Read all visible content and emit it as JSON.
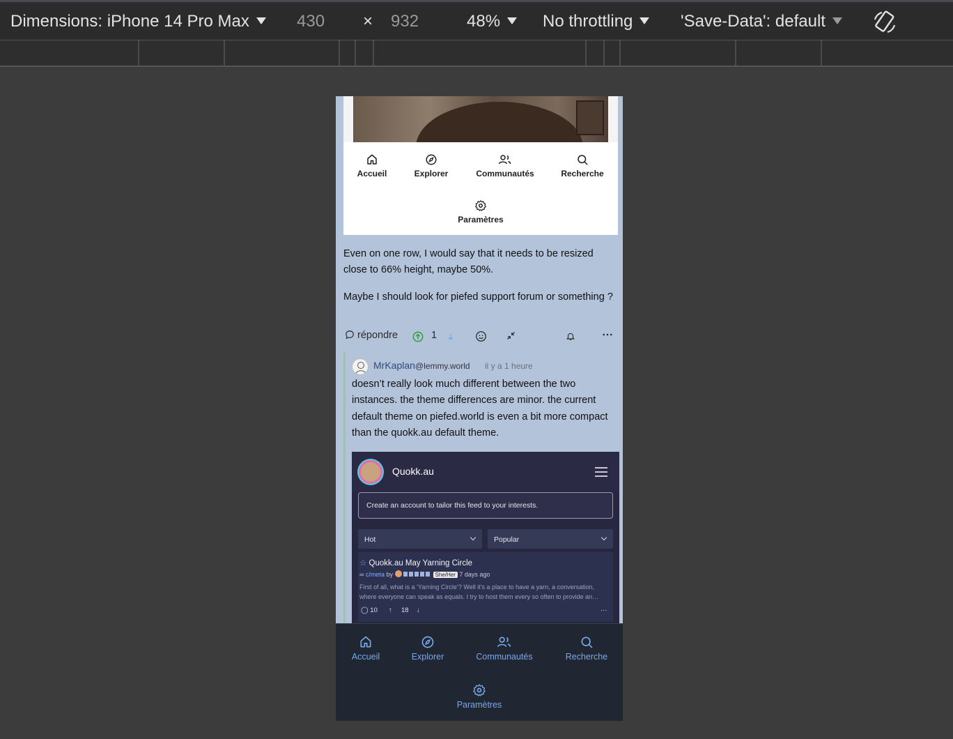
{
  "devtools": {
    "dimensions_label": "Dimensions: iPhone 14 Pro Max",
    "width": "430",
    "times": "×",
    "height": "932",
    "zoom": "48%",
    "throttling": "No throttling",
    "save_data": "'Save-Data': default"
  },
  "card_nav": {
    "items": [
      {
        "label": "Accueil",
        "icon": "home-icon"
      },
      {
        "label": "Explorer",
        "icon": "compass-icon"
      },
      {
        "label": "Communautés",
        "icon": "users-icon"
      },
      {
        "label": "Recherche",
        "icon": "search-icon"
      },
      {
        "label": "Paramètres",
        "icon": "gear-icon"
      }
    ]
  },
  "comment": {
    "paragraph1": "Even on one row, I would say that it needs to be resized close to 66% height, maybe 50%.",
    "paragraph2": "Maybe I should look for piefed support forum or something ?",
    "actions": {
      "reply_label": "répondre",
      "score": "1"
    }
  },
  "reply": {
    "author": "MrKaplan",
    "instance": "@lemmy.world",
    "time": "il y a 1 heure",
    "body": "doesn’t really look much different between the two instances. the theme differences are minor. the current default theme on piefed.world is even a bit more compact than the quokk.au default theme."
  },
  "screenshot": {
    "site_name": "Quokk.au",
    "banner": "Create an account to tailor this feed to your interests.",
    "sort1": "Hot",
    "sort2": "Popular",
    "post": {
      "title": "Quokk.au May Yarning Circle",
      "community": "c/meta",
      "by": "by",
      "pronoun_tag": "She/Her",
      "age": "7 days ago",
      "text": "First of all, what is a ‘Yarning Circle’? Well it’s a place to have a yarn, a conversation, where everyone can speak as equals. I try to host them every so often to provide an…",
      "comments": "10",
      "votes": "18",
      "more": "···"
    }
  },
  "bottom_nav": {
    "items": [
      {
        "label": "Accueil",
        "icon": "home-icon"
      },
      {
        "label": "Explorer",
        "icon": "compass-icon"
      },
      {
        "label": "Communautés",
        "icon": "users-icon"
      },
      {
        "label": "Recherche",
        "icon": "search-icon"
      },
      {
        "label": "Paramètres",
        "icon": "gear-icon"
      }
    ]
  },
  "colors": {
    "page_bg": "#b3c3d9",
    "accent_blue": "#77a8ec",
    "upvote_green": "#2e9d3a",
    "thread_line": "#9fc79a"
  }
}
